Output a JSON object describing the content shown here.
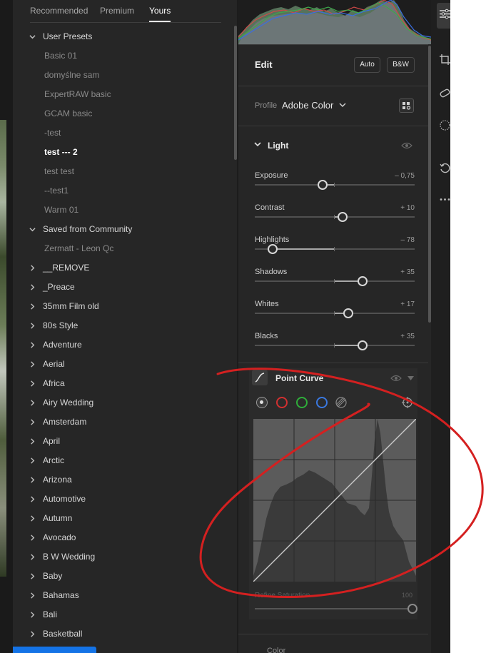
{
  "presets_panel": {
    "tabs": [
      {
        "label": "Recommended",
        "active": false
      },
      {
        "label": "Premium",
        "active": false
      },
      {
        "label": "Yours",
        "active": true
      }
    ],
    "items": [
      {
        "label": "User Presets",
        "type": "group",
        "expanded": true
      },
      {
        "label": "Basic 01",
        "type": "child"
      },
      {
        "label": "domyślne sam",
        "type": "child"
      },
      {
        "label": "ExpertRAW basic",
        "type": "child"
      },
      {
        "label": "GCAM basic",
        "type": "child"
      },
      {
        "label": "-test",
        "type": "child"
      },
      {
        "label": "test --- 2",
        "type": "child",
        "selected": true
      },
      {
        "label": "test test",
        "type": "child"
      },
      {
        "label": "--test1",
        "type": "child"
      },
      {
        "label": "Warm 01",
        "type": "child"
      },
      {
        "label": "Saved from Community",
        "type": "group",
        "expanded": true
      },
      {
        "label": "Zermatt - Leon Qc",
        "type": "child"
      },
      {
        "label": "__REMOVE",
        "type": "group",
        "expanded": false
      },
      {
        "label": "_Preace",
        "type": "group",
        "expanded": false
      },
      {
        "label": "35mm Film old",
        "type": "group",
        "expanded": false
      },
      {
        "label": "80s Style",
        "type": "group",
        "expanded": false
      },
      {
        "label": "Adventure",
        "type": "group",
        "expanded": false
      },
      {
        "label": "Aerial",
        "type": "group",
        "expanded": false
      },
      {
        "label": "Africa",
        "type": "group",
        "expanded": false
      },
      {
        "label": "Airy Wedding",
        "type": "group",
        "expanded": false
      },
      {
        "label": "Amsterdam",
        "type": "group",
        "expanded": false
      },
      {
        "label": "April",
        "type": "group",
        "expanded": false
      },
      {
        "label": "Arctic",
        "type": "group",
        "expanded": false
      },
      {
        "label": "Arizona",
        "type": "group",
        "expanded": false
      },
      {
        "label": "Automotive",
        "type": "group",
        "expanded": false
      },
      {
        "label": "Autumn",
        "type": "group",
        "expanded": false
      },
      {
        "label": "Avocado",
        "type": "group",
        "expanded": false
      },
      {
        "label": "B W Wedding",
        "type": "group",
        "expanded": false
      },
      {
        "label": "Baby",
        "type": "group",
        "expanded": false
      },
      {
        "label": "Bahamas",
        "type": "group",
        "expanded": false
      },
      {
        "label": "Bali",
        "type": "group",
        "expanded": false
      },
      {
        "label": "Basketball",
        "type": "group",
        "expanded": false
      }
    ]
  },
  "edit_panel": {
    "title": "Edit",
    "auto_label": "Auto",
    "bw_label": "B&W",
    "profile_label": "Profile",
    "profile_value": "Adobe Color",
    "light_title": "Light",
    "sliders": [
      {
        "name": "Exposure",
        "value_text": "– 0,75",
        "value": -0.75,
        "min": -5,
        "max": 5
      },
      {
        "name": "Contrast",
        "value_text": "+ 10",
        "value": 10,
        "min": -100,
        "max": 100
      },
      {
        "name": "Highlights",
        "value_text": "– 78",
        "value": -78,
        "min": -100,
        "max": 100
      },
      {
        "name": "Shadows",
        "value_text": "+ 35",
        "value": 35,
        "min": -100,
        "max": 100
      },
      {
        "name": "Whites",
        "value_text": "+ 17",
        "value": 17,
        "min": -100,
        "max": 100
      },
      {
        "name": "Blacks",
        "value_text": "+ 35",
        "value": 35,
        "min": -100,
        "max": 100
      }
    ],
    "point_curve": {
      "title": "Point Curve",
      "channels": [
        {
          "name": "luminance",
          "color": "#cfcfcf",
          "active": true
        },
        {
          "name": "red",
          "color": "#d23030",
          "active": false
        },
        {
          "name": "green",
          "color": "#2fae3a",
          "active": false
        },
        {
          "name": "blue",
          "color": "#3a78e0",
          "active": false
        }
      ],
      "refine_label": "Refine Saturation",
      "refine_value": "100"
    },
    "next_section": "Color"
  },
  "colors": {
    "panel": "#262626",
    "accent_blue": "#1473e6",
    "annotation_red": "#d42020"
  },
  "tool_icons": [
    "edit-sliders-icon",
    "crop-icon",
    "healing-icon",
    "masking-icon",
    "history-icon",
    "more-icon"
  ]
}
